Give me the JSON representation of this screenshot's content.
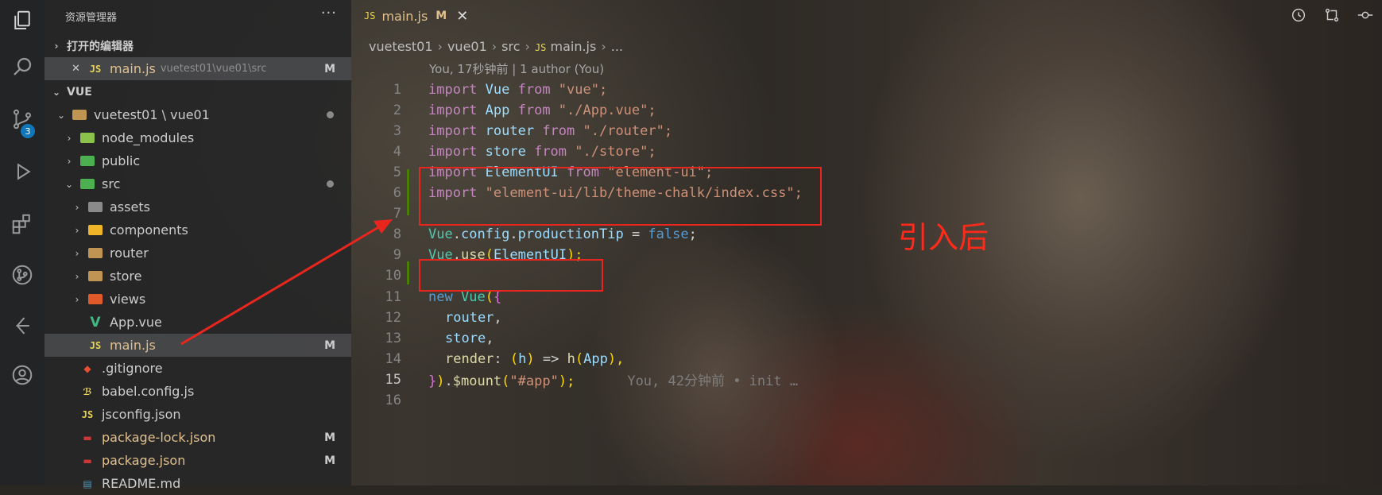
{
  "explorer": {
    "title": "资源管理器",
    "more": "···",
    "open_editors_header": "打开的编辑器",
    "open_editor": {
      "close": "✕",
      "lang": "JS",
      "name": "main.js",
      "path": "vuetest01\\vue01\\src",
      "status": "M"
    },
    "project_header": "VUE",
    "tree": [
      {
        "label": "vuetest01 \\ vue01",
        "chev": "⌄",
        "kind": "folder",
        "level": 1
      },
      {
        "label": "node_modules",
        "chev": "›",
        "kind": "folder",
        "level": 2
      },
      {
        "label": "public",
        "chev": "›",
        "kind": "folder",
        "level": 2
      },
      {
        "label": "src",
        "chev": "⌄",
        "kind": "folder",
        "level": 2
      },
      {
        "label": "assets",
        "chev": "›",
        "kind": "folder",
        "level": 3
      },
      {
        "label": "components",
        "chev": "›",
        "kind": "folder",
        "level": 3
      },
      {
        "label": "router",
        "chev": "›",
        "kind": "folder",
        "level": 3
      },
      {
        "label": "store",
        "chev": "›",
        "kind": "folder",
        "level": 3
      },
      {
        "label": "views",
        "chev": "›",
        "kind": "folder",
        "level": 3
      },
      {
        "label": "App.vue",
        "kind": "vue",
        "level": 3
      },
      {
        "label": "main.js",
        "kind": "js",
        "level": 3,
        "status": "M"
      },
      {
        "label": ".gitignore",
        "kind": "git",
        "level": 2
      },
      {
        "label": "babel.config.js",
        "kind": "babel",
        "level": 2
      },
      {
        "label": "jsconfig.json",
        "kind": "js",
        "level": 2
      },
      {
        "label": "package-lock.json",
        "kind": "npm",
        "level": 2,
        "status": "M"
      },
      {
        "label": "package.json",
        "kind": "npm",
        "level": 2,
        "status": "M"
      },
      {
        "label": "README.md",
        "kind": "md",
        "level": 2
      }
    ]
  },
  "activity": {
    "scm_badge": "3"
  },
  "tab": {
    "lang": "JS",
    "name": "main.js",
    "status": "M",
    "close": "✕"
  },
  "breadcrumb": {
    "parts": [
      "vuetest01",
      "vue01",
      "src"
    ],
    "lang": "JS",
    "file": "main.js",
    "tail": "..."
  },
  "blame_header": "You, 17秒钟前 | 1 author (You)",
  "code": {
    "line_numbers": [
      "1",
      "2",
      "3",
      "4",
      "5",
      "6",
      "7",
      "8",
      "9",
      "10",
      "11",
      "12",
      "13",
      "14",
      "15",
      "16"
    ],
    "l1": [
      "import",
      " Vue ",
      "from",
      " \"vue\";"
    ],
    "l2": [
      "import",
      " App ",
      "from",
      " \"./App.vue\";"
    ],
    "l3": [
      "import",
      " router ",
      "from",
      " \"./router\";"
    ],
    "l4": [
      "import",
      " store ",
      "from",
      " \"./store\";"
    ],
    "l5": [
      "import",
      " ElementUI ",
      "from",
      " \"element-ui\";"
    ],
    "l6": [
      "import",
      " \"element-ui/lib/theme-chalk/index.css\";"
    ],
    "l8": [
      "Vue",
      ".",
      "config",
      ".",
      "productionTip",
      " = ",
      "false",
      ";"
    ],
    "l9": [
      "Vue",
      ".",
      "use",
      "(",
      "ElementUI",
      ");"
    ],
    "l11": [
      "new",
      " ",
      "Vue",
      "(",
      "{"
    ],
    "l12": [
      "router",
      ","
    ],
    "l13": [
      "store",
      ","
    ],
    "l14": [
      "render",
      ": ",
      "(",
      "h",
      ")",
      " => ",
      "h",
      "(",
      "App",
      "),"
    ],
    "l15": [
      "}",
      ")",
      ".",
      "$mount",
      "(",
      "\"#app\"",
      ");"
    ],
    "l15_blame": "You, 42分钟前 • init …"
  },
  "annotation": "引入后"
}
